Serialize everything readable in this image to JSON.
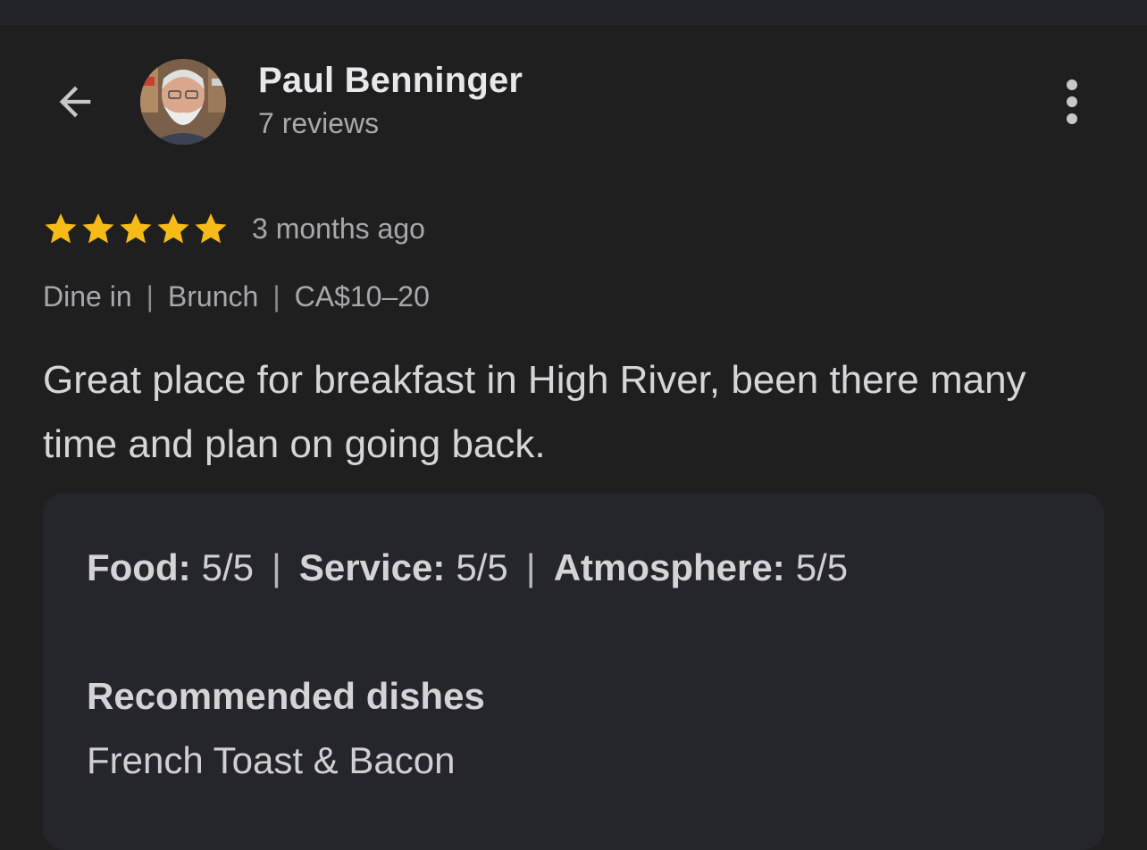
{
  "header": {
    "back_icon": "arrow-left-icon",
    "author_name": "Paul Benninger",
    "review_count": "7 reviews",
    "more_icon": "more-vertical-icon"
  },
  "review": {
    "rating": 5,
    "rating_max": 5,
    "star_color": "#f6bb16",
    "time_ago": "3 months ago",
    "meta": {
      "service_type": "Dine in",
      "meal_type": "Brunch",
      "price_range": "CA$10–20"
    },
    "text": "Great place for breakfast in High River, been there many time and plan on going back."
  },
  "details": {
    "food_label": "Food:",
    "food_score": "5/5",
    "service_label": "Service:",
    "service_score": "5/5",
    "atmosphere_label": "Atmosphere:",
    "atmosphere_score": "5/5",
    "separator": "|",
    "recommended_title": "Recommended dishes",
    "recommended_value": "French Toast & Bacon"
  }
}
